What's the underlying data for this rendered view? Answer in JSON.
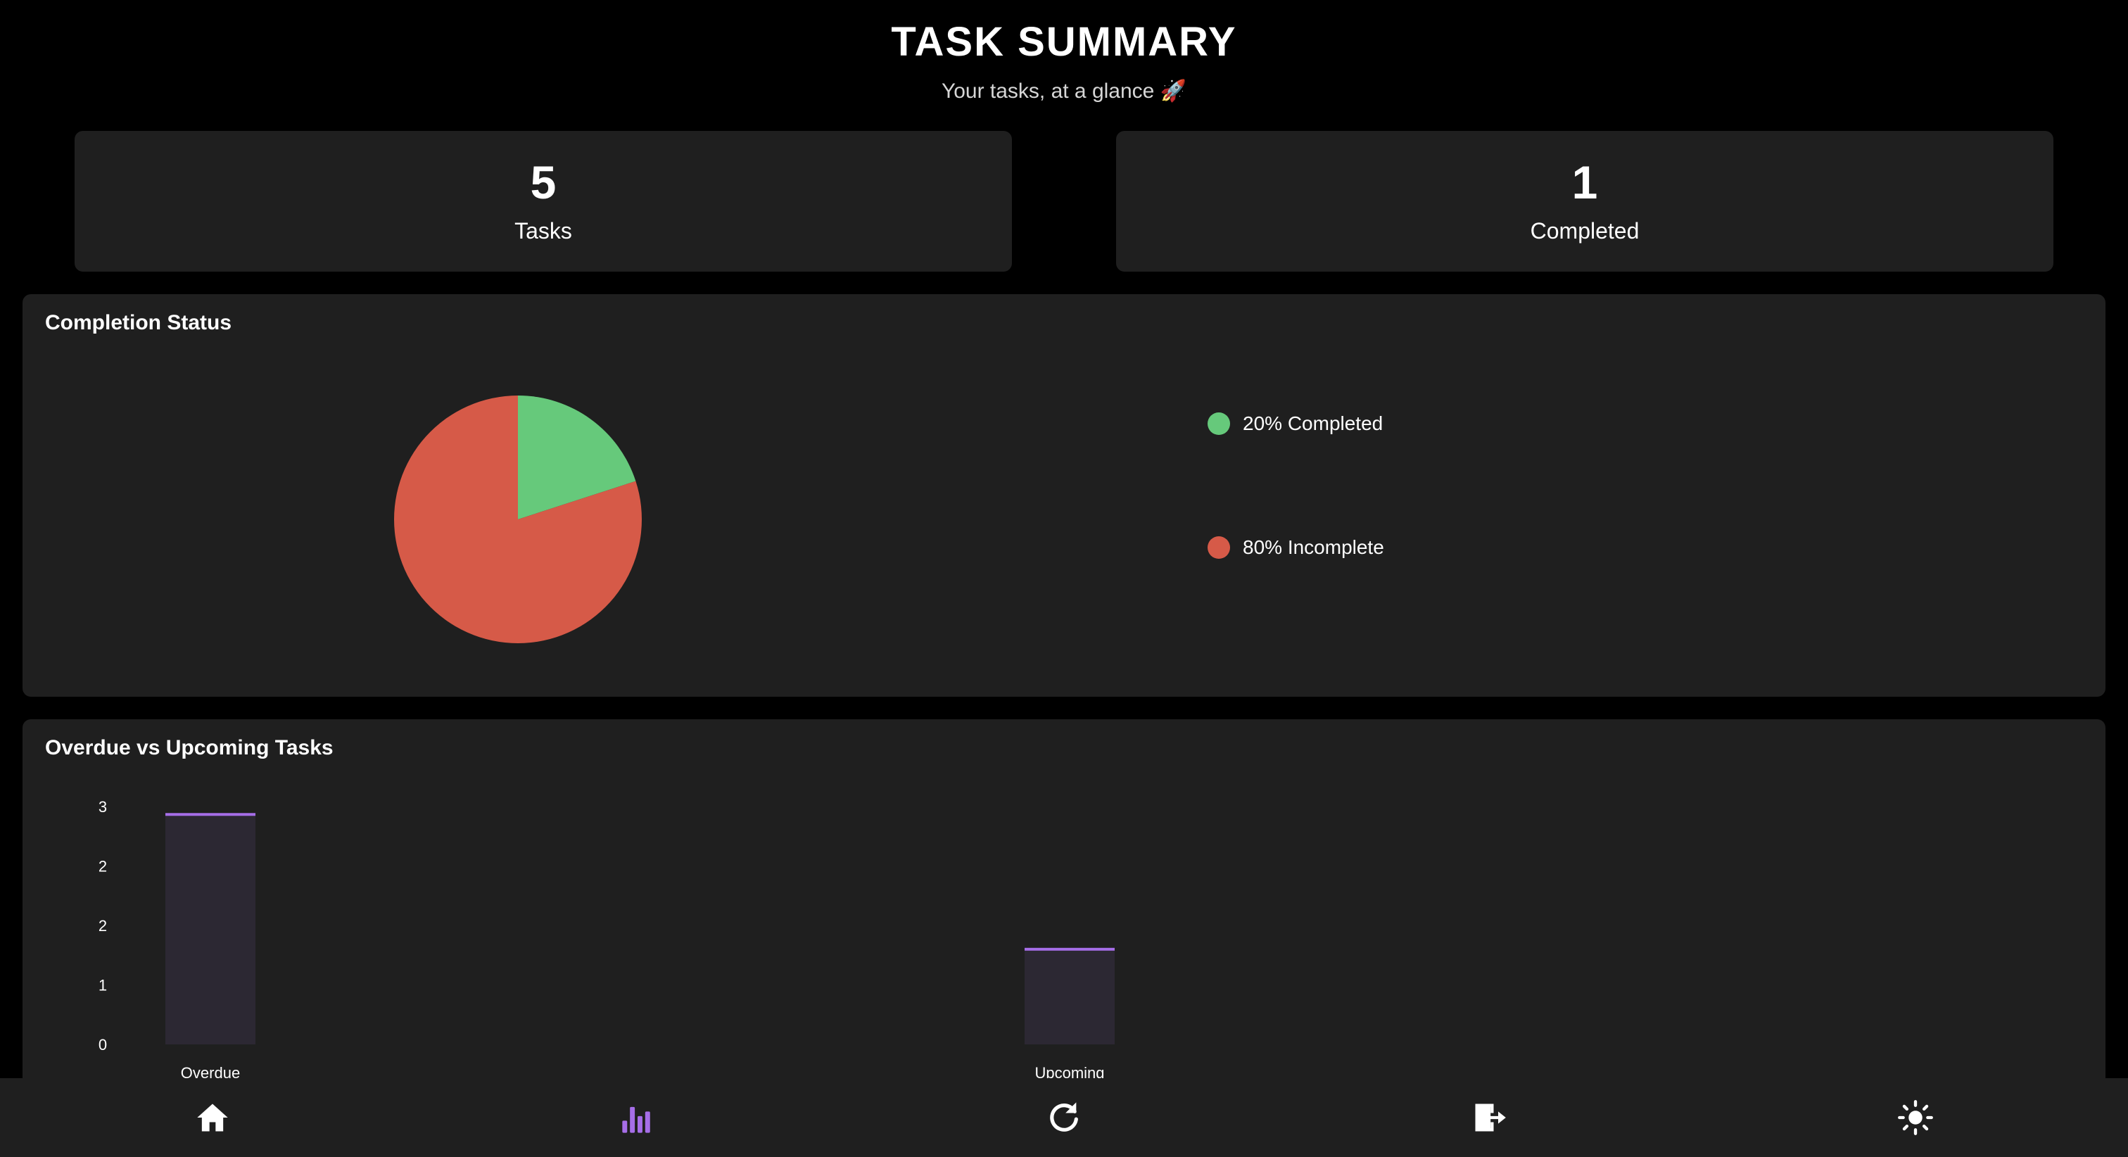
{
  "header": {
    "title": "TASK SUMMARY",
    "subtitle": "Your tasks, at a glance 🚀"
  },
  "stats": [
    {
      "value": "5",
      "label": "Tasks"
    },
    {
      "value": "1",
      "label": "Completed"
    }
  ],
  "colors": {
    "completed": "#66c97b",
    "incomplete": "#d65a48",
    "accent": "#a66ee8",
    "bar_fill": "#2c2833",
    "panel": "#1f1f1f",
    "background": "#000000"
  },
  "completion_panel": {
    "title": "Completion Status",
    "legend": [
      {
        "label": "20% Completed",
        "color": "#66c97b"
      },
      {
        "label": "80% Incomplete",
        "color": "#d65a48"
      }
    ]
  },
  "bar_panel": {
    "title": "Overdue vs Upcoming Tasks"
  },
  "chart_data": [
    {
      "type": "pie",
      "title": "Completion Status",
      "categories": [
        "Completed",
        "Incomplete"
      ],
      "values": [
        20,
        80
      ],
      "legend_labels": [
        "20% Completed",
        "80% Incomplete"
      ],
      "colors": [
        "#66c97b",
        "#d65a48"
      ],
      "legend_position": "right"
    },
    {
      "type": "bar",
      "title": "Overdue vs Upcoming Tasks",
      "categories": [
        "Overdue",
        "Upcoming"
      ],
      "values": [
        2.9,
        1.2
      ],
      "ylim": [
        0,
        3
      ],
      "ytick_values": [
        0,
        0.75,
        1.5,
        2.25,
        3
      ],
      "ytick_labels": [
        "0",
        "1",
        "2",
        "2",
        "3"
      ],
      "grid": false
    }
  ],
  "nav": {
    "items": [
      {
        "name": "home",
        "icon": "home-icon"
      },
      {
        "name": "stats",
        "icon": "bar-chart-icon",
        "active": true
      },
      {
        "name": "refresh",
        "icon": "refresh-icon"
      },
      {
        "name": "logout",
        "icon": "logout-icon"
      },
      {
        "name": "theme",
        "icon": "sun-icon"
      }
    ]
  }
}
